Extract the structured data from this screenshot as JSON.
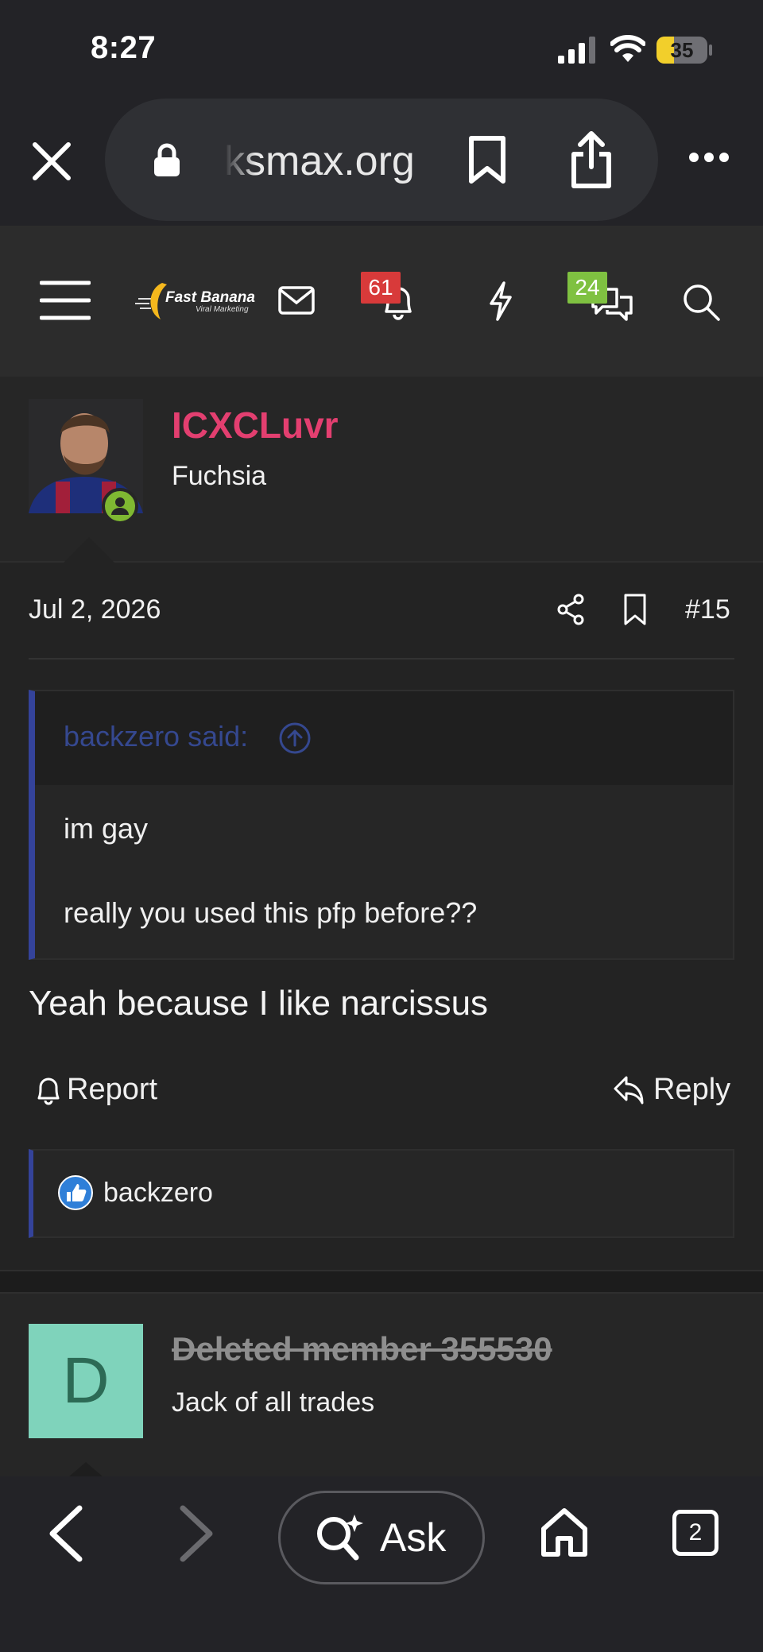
{
  "status_bar": {
    "time": "8:27",
    "battery": "35",
    "battery_level": 0.35
  },
  "browser": {
    "domain": "ksmax.org",
    "icons": [
      "close-icon",
      "lock-icon",
      "bookmark-icon",
      "share-icon",
      "more-icon"
    ]
  },
  "forum_header": {
    "logo_text": "Fast Banana",
    "logo_subtext": "Viral Marketing",
    "alerts_badge": "61",
    "conversations_badge": "24",
    "icons": [
      "menu-icon",
      "mail-icon",
      "bell-icon",
      "bolt-icon",
      "chat-icon",
      "search-icon"
    ],
    "colors": {
      "alerts_badge": "#d83a3a",
      "conversations_badge": "#7fc141"
    }
  },
  "post": {
    "username": "ICXCLuvr",
    "user_title": "Fuchsia",
    "date": "Jul 2, 2026",
    "post_number": "#15",
    "quote": {
      "author_label": "backzero said:",
      "lines": [
        "im gay",
        "really you used this pfp before??"
      ]
    },
    "body": "Yeah because I like narcissus",
    "actions": {
      "report": "Report",
      "reply": "Reply"
    },
    "reactions": {
      "users": "backzero"
    },
    "colors": {
      "username": "#e33f70",
      "quote_accent": "#34439a"
    }
  },
  "next_post": {
    "avatar_letter": "D",
    "username": "Deleted member 355530",
    "user_title": "Jack of all trades",
    "colors": {
      "avatar_bg": "#7fd3bb"
    }
  },
  "toolbar": {
    "ask_label": "Ask",
    "tab_count": "2"
  }
}
